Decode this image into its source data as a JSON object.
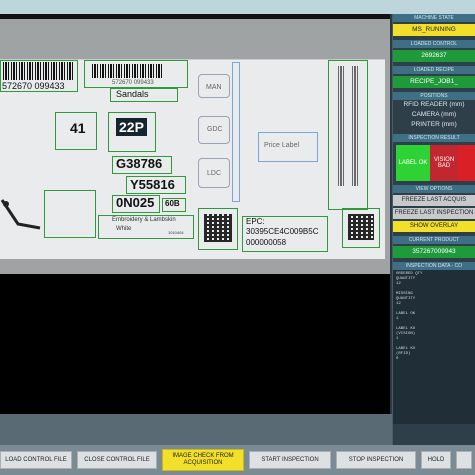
{
  "label": {
    "barcode_number": "572670 099433",
    "barcode_number_small": "572670 099433",
    "sandals": "Sandals",
    "size_41": "41",
    "size_22p": "22P",
    "code_g": "G38786",
    "code_y": "Y55816",
    "code_0n": "0N025",
    "code_60b": "60B",
    "embroidery": "Embroidery & Lambskin",
    "white": "White",
    "tiny_code": "1010404",
    "man": "MAN",
    "gdc": "GDC",
    "ldc": "LDC",
    "price_label": "Price Label",
    "epc_label": "EPC:",
    "epc_value": "30395CE4C009B5C",
    "epc_value2": "000000058"
  },
  "panel": {
    "machine_state_title": "MACHINE STATE",
    "machine_state_value": "MS_RUNNING",
    "loaded_control_title": "LOADED CONTROL",
    "loaded_control_value": "2692637",
    "loaded_recipe_title": "LOADED RECIPE",
    "loaded_recipe_value": "RECIPE_JOB1_",
    "positions_title": "POSITIONS",
    "pos_rfid": "RFID READER (mm)",
    "pos_camera": "CAMERA (mm)",
    "pos_printer": "PRINTER (mm)",
    "inspection_result_title": "INSPECTION RESULT",
    "label_ok": "LABEL OK",
    "vision_bad": "VISION BAD",
    "view_options_title": "VIEW OPTIONS",
    "freeze_last_acq": "FREEZE LAST ACQUIS",
    "freeze_last_insp": "FREEZE LAST INSPECTION",
    "show_overlay": "SHOW OVERLAY",
    "current_product_title": "CURRENT PRODUCT",
    "current_product_value": "357267009943",
    "inspection_data_title": "INSPECTION DATA - CO",
    "data_lines": [
      "ORDERED QTY",
      "QUANTITY",
      "12",
      "",
      "MISSING",
      "QUANTITY",
      "12",
      "",
      "LABEL OK",
      "1",
      "",
      "LABEL KO",
      "(VISION)",
      "1",
      "",
      "LABEL KO",
      "(RFID)",
      "0"
    ]
  },
  "toolbar": {
    "load_control_file": "LOAD CONTROL FILE",
    "close_control_file": "CLOSE CONTROL FILE",
    "image_check": "IMAGE CHECK FROM ACQUISITION",
    "start_inspection": "START INSPECTION",
    "stop_inspection": "STOP INSPECTION",
    "hold": "HOLD",
    "extra": ""
  },
  "colors": {
    "machine_state_bg": "#f2df2a",
    "loaded_value_bg": "#1e9a3a",
    "label_ok_bg": "#2fd235",
    "vision_bad_bg": "#c2262e",
    "highlight_yellow": "#f2df2a"
  }
}
